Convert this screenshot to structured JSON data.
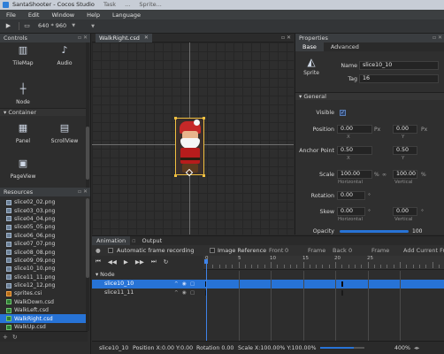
{
  "window": {
    "title": "SantaShooter - Cocos Studio",
    "ghost_text": [
      "Task",
      "...",
      "Sprite..."
    ]
  },
  "menu": [
    "File",
    "Edit",
    "Window",
    "Help",
    "Language"
  ],
  "toolbar": {
    "resolution": "640 * 960"
  },
  "controls": {
    "header": "Controls",
    "items_top": [
      "TileMap",
      "Audio"
    ],
    "items_node": [
      "Node"
    ],
    "container_header": "Container",
    "container_items": [
      "Panel",
      "ScrollView",
      "PageView"
    ]
  },
  "resources": {
    "header": "Resources",
    "items": [
      {
        "name": "slice02_02.png",
        "type": "png"
      },
      {
        "name": "slice03_03.png",
        "type": "png"
      },
      {
        "name": "slice04_04.png",
        "type": "png"
      },
      {
        "name": "slice05_05.png",
        "type": "png"
      },
      {
        "name": "slice06_06.png",
        "type": "png"
      },
      {
        "name": "slice07_07.png",
        "type": "png"
      },
      {
        "name": "slice08_08.png",
        "type": "png"
      },
      {
        "name": "slice09_09.png",
        "type": "png"
      },
      {
        "name": "slice10_10.png",
        "type": "png"
      },
      {
        "name": "slice11_11.png",
        "type": "png"
      },
      {
        "name": "slice12_12.png",
        "type": "png"
      },
      {
        "name": "sprites.csi",
        "type": "csi"
      },
      {
        "name": "WalkDown.csd",
        "type": "csd"
      },
      {
        "name": "WalkLeft.csd",
        "type": "csd"
      },
      {
        "name": "WalkRight.csd",
        "type": "csd",
        "selected": true
      },
      {
        "name": "WalkUp.csd",
        "type": "csd"
      }
    ]
  },
  "document": {
    "tab": "WalkRight.csd"
  },
  "properties": {
    "header": "Properties",
    "tabs": [
      "Base",
      "Advanced"
    ],
    "sprite_label": "Sprite",
    "name_label": "Name",
    "name_value": "slice10_10",
    "tag_label": "Tag",
    "tag_value": "16",
    "general_header": "General",
    "visible_label": "Visible",
    "position_label": "Position",
    "position_x": "0.00",
    "position_y": "0.00",
    "position_unit": "Px",
    "x_label": "X",
    "y_label": "Y",
    "anchor_label": "Anchor Point",
    "anchor_x": "0.50",
    "anchor_y": "0.50",
    "scale_label": "Scale",
    "scale_x": "100.00",
    "scale_y": "100.00",
    "percent": "%",
    "link_symbol": "∞",
    "horizontal_label": "Horizontal",
    "vertical_label": "Vertical",
    "rotation_label": "Rotation",
    "rotation_value": "0.00",
    "degree": "°",
    "skew_label": "Skew",
    "skew_x": "0.00",
    "skew_y": "0.00",
    "opacity_label": "Opacity",
    "opacity_value": "100",
    "opacity_fraction": 1.0
  },
  "animation": {
    "tabs": [
      "Animation",
      "Output"
    ],
    "auto_record_label": "Automatic frame recording",
    "image_ref_label": "Image Reference",
    "front_label": "Front",
    "front_value": "0",
    "frame_label_1": "Frame",
    "back_label": "Back",
    "back_value": "0",
    "frame_label_2": "Frame",
    "add_label": "Add Current Fr",
    "ruler_numbers": [
      "0",
      "5",
      "10",
      "15",
      "20",
      "25"
    ],
    "tree": [
      {
        "label": "Node",
        "level": 0
      },
      {
        "label": "slice10_10",
        "level": 1,
        "selected": true
      },
      {
        "label": "slice11_11",
        "level": 1
      }
    ]
  },
  "statusbar": {
    "node": "slice10_10",
    "position": "Position X:0.00  Y:0.00",
    "rotation": "Rotation 0.00",
    "scale": "Scale X:100.00%  Y:100.00%",
    "zoom": "400%"
  }
}
